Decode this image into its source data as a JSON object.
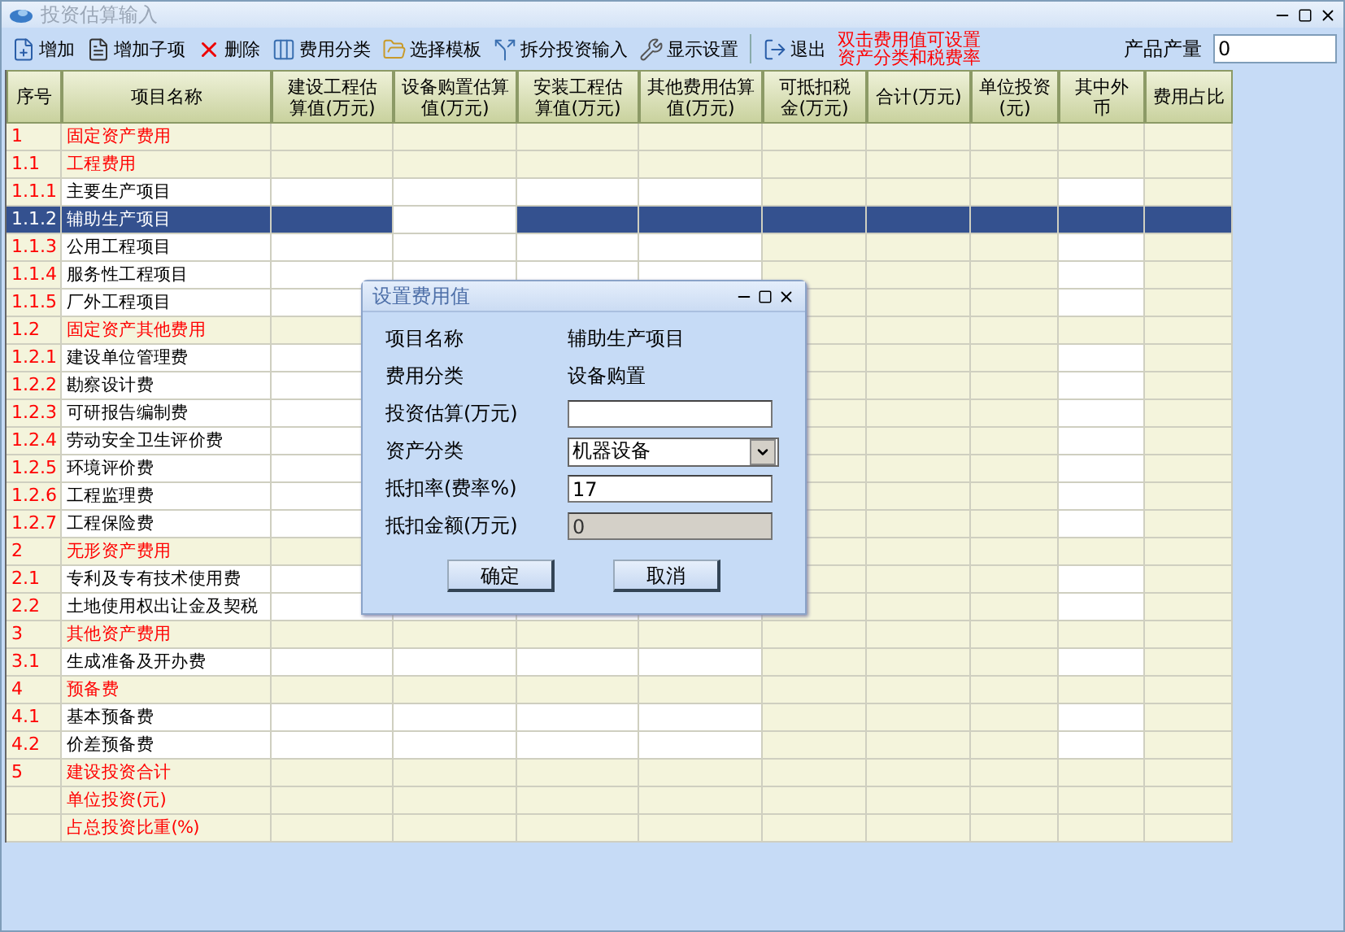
{
  "window": {
    "title": "投资估算输入"
  },
  "toolbar": {
    "items": [
      {
        "kind": "add",
        "label": "增加"
      },
      {
        "kind": "add-child",
        "label": "增加子项"
      },
      {
        "kind": "delete",
        "label": "删除"
      },
      {
        "kind": "category",
        "label": "费用分类"
      },
      {
        "kind": "template",
        "label": "选择模板"
      },
      {
        "kind": "split",
        "label": "拆分投资输入"
      },
      {
        "kind": "settings",
        "label": "显示设置"
      },
      {
        "kind": "exit",
        "label": "退出"
      }
    ],
    "hint": [
      "双击费用值可设置",
      "资产分类和税费率"
    ],
    "output_label": "产品产量",
    "output_value": "0"
  },
  "table": {
    "columns": [
      {
        "label": "序号",
        "focused": false
      },
      {
        "label": "项目名称",
        "focused": false
      },
      {
        "label": "建设工程估算值(万元)",
        "focused": false
      },
      {
        "label": "设备购置估算值(万元)",
        "focused": true
      },
      {
        "label": "安装工程估算值(万元)",
        "focused": false
      },
      {
        "label": "其他费用估算值(万元)",
        "focused": false
      },
      {
        "label": "可抵扣税金(万元)",
        "focused": false
      },
      {
        "label": "合计(万元)",
        "focused": false
      },
      {
        "label": "单位投资(元)",
        "focused": false
      },
      {
        "label": "其中外币",
        "focused": false
      },
      {
        "label": "费用占比",
        "focused": false
      }
    ],
    "rows": [
      {
        "no": "1",
        "name": "固定资产费用",
        "kind": "group",
        "selected": false
      },
      {
        "no": "1.1",
        "name": "工程费用",
        "kind": "group",
        "selected": false
      },
      {
        "no": "1.1.1",
        "name": "主要生产项目",
        "kind": "item",
        "selected": false
      },
      {
        "no": "1.1.2",
        "name": "辅助生产项目",
        "kind": "item",
        "selected": true
      },
      {
        "no": "1.1.3",
        "name": "公用工程项目",
        "kind": "item",
        "selected": false
      },
      {
        "no": "1.1.4",
        "name": "服务性工程项目",
        "kind": "item",
        "selected": false
      },
      {
        "no": "1.1.5",
        "name": "厂外工程项目",
        "kind": "item",
        "selected": false
      },
      {
        "no": "1.2",
        "name": "固定资产其他费用",
        "kind": "group",
        "selected": false
      },
      {
        "no": "1.2.1",
        "name": "建设单位管理费",
        "kind": "item",
        "selected": false
      },
      {
        "no": "1.2.2",
        "name": "勘察设计费",
        "kind": "item",
        "selected": false
      },
      {
        "no": "1.2.3",
        "name": "可研报告编制费",
        "kind": "item",
        "selected": false
      },
      {
        "no": "1.2.4",
        "name": "劳动安全卫生评价费",
        "kind": "item",
        "selected": false
      },
      {
        "no": "1.2.5",
        "name": "环境评价费",
        "kind": "item",
        "selected": false
      },
      {
        "no": "1.2.6",
        "name": "工程监理费",
        "kind": "item",
        "selected": false
      },
      {
        "no": "1.2.7",
        "name": "工程保险费",
        "kind": "item",
        "selected": false
      },
      {
        "no": "2",
        "name": "无形资产费用",
        "kind": "group",
        "selected": false
      },
      {
        "no": "2.1",
        "name": "专利及专有技术使用费",
        "kind": "item",
        "selected": false
      },
      {
        "no": "2.2",
        "name": "土地使用权出让金及契税",
        "kind": "item",
        "selected": false
      },
      {
        "no": "3",
        "name": "其他资产费用",
        "kind": "group",
        "selected": false
      },
      {
        "no": "3.1",
        "name": "生成准备及开办费",
        "kind": "item",
        "selected": false
      },
      {
        "no": "4",
        "name": "预备费",
        "kind": "group",
        "selected": false
      },
      {
        "no": "4.1",
        "name": "基本预备费",
        "kind": "item",
        "selected": false
      },
      {
        "no": "4.2",
        "name": "价差预备费",
        "kind": "item",
        "selected": false
      },
      {
        "no": "5",
        "name": "建设投资合计",
        "kind": "group",
        "selected": false
      },
      {
        "name": "单位投资(元)",
        "kind": "group",
        "selected": false
      },
      {
        "name": "占总投资比重(%)",
        "kind": "group",
        "selected": false
      }
    ]
  },
  "dialog": {
    "title": "设置费用值",
    "fields": [
      {
        "kind": "text",
        "label": "项目名称",
        "value": "辅助生产项目"
      },
      {
        "kind": "text",
        "label": "费用分类",
        "value": "设备购置"
      },
      {
        "kind": "input",
        "label": "投资估算(万元)"
      },
      {
        "kind": "select",
        "label": "资产分类",
        "value": "机器设备"
      },
      {
        "kind": "input",
        "label": "抵扣率(费率%)",
        "value": "17"
      },
      {
        "kind": "disabled",
        "label": "抵扣金额(万元)",
        "value": "0"
      }
    ],
    "buttons": [
      "确定",
      "取消"
    ]
  }
}
